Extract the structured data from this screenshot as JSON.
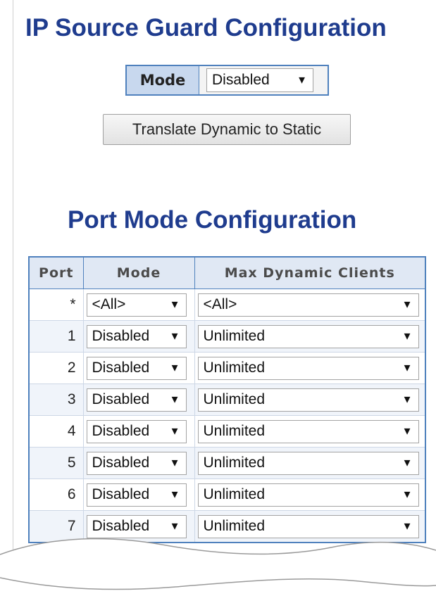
{
  "page": {
    "title": "IP Source Guard Configuration",
    "global_mode": {
      "label": "Mode",
      "value": "Disabled"
    },
    "translate_button": "Translate Dynamic to Static"
  },
  "port_section": {
    "title": "Port Mode Configuration",
    "columns": [
      "Port",
      "Mode",
      "Max Dynamic Clients"
    ],
    "rows": [
      {
        "port": "*",
        "mode": "<All>",
        "max": "<All>"
      },
      {
        "port": "1",
        "mode": "Disabled",
        "max": "Unlimited"
      },
      {
        "port": "2",
        "mode": "Disabled",
        "max": "Unlimited"
      },
      {
        "port": "3",
        "mode": "Disabled",
        "max": "Unlimited"
      },
      {
        "port": "4",
        "mode": "Disabled",
        "max": "Unlimited"
      },
      {
        "port": "5",
        "mode": "Disabled",
        "max": "Unlimited"
      },
      {
        "port": "6",
        "mode": "Disabled",
        "max": "Unlimited"
      },
      {
        "port": "7",
        "mode": "Disabled",
        "max": "Unlimited"
      }
    ]
  },
  "colors": {
    "title": "#1f3c8e",
    "border": "#4f81bd",
    "header_bg": "#e0e8f4"
  },
  "icons": {
    "dropdown": "triangle-down-icon"
  }
}
